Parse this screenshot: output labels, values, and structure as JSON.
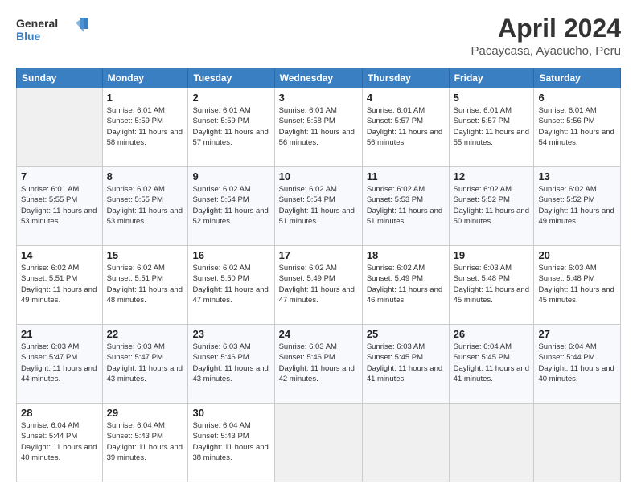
{
  "header": {
    "logo_line1": "General",
    "logo_line2": "Blue",
    "title": "April 2024",
    "location": "Pacaycasa, Ayacucho, Peru"
  },
  "weekdays": [
    "Sunday",
    "Monday",
    "Tuesday",
    "Wednesday",
    "Thursday",
    "Friday",
    "Saturday"
  ],
  "weeks": [
    [
      {
        "day": "",
        "empty": true
      },
      {
        "day": "1",
        "sunrise": "6:01 AM",
        "sunset": "5:59 PM",
        "daylight": "11 hours and 58 minutes."
      },
      {
        "day": "2",
        "sunrise": "6:01 AM",
        "sunset": "5:59 PM",
        "daylight": "11 hours and 57 minutes."
      },
      {
        "day": "3",
        "sunrise": "6:01 AM",
        "sunset": "5:58 PM",
        "daylight": "11 hours and 56 minutes."
      },
      {
        "day": "4",
        "sunrise": "6:01 AM",
        "sunset": "5:57 PM",
        "daylight": "11 hours and 56 minutes."
      },
      {
        "day": "5",
        "sunrise": "6:01 AM",
        "sunset": "5:57 PM",
        "daylight": "11 hours and 55 minutes."
      },
      {
        "day": "6",
        "sunrise": "6:01 AM",
        "sunset": "5:56 PM",
        "daylight": "11 hours and 54 minutes."
      }
    ],
    [
      {
        "day": "7",
        "sunrise": "6:01 AM",
        "sunset": "5:55 PM",
        "daylight": "11 hours and 53 minutes."
      },
      {
        "day": "8",
        "sunrise": "6:02 AM",
        "sunset": "5:55 PM",
        "daylight": "11 hours and 53 minutes."
      },
      {
        "day": "9",
        "sunrise": "6:02 AM",
        "sunset": "5:54 PM",
        "daylight": "11 hours and 52 minutes."
      },
      {
        "day": "10",
        "sunrise": "6:02 AM",
        "sunset": "5:54 PM",
        "daylight": "11 hours and 51 minutes."
      },
      {
        "day": "11",
        "sunrise": "6:02 AM",
        "sunset": "5:53 PM",
        "daylight": "11 hours and 51 minutes."
      },
      {
        "day": "12",
        "sunrise": "6:02 AM",
        "sunset": "5:52 PM",
        "daylight": "11 hours and 50 minutes."
      },
      {
        "day": "13",
        "sunrise": "6:02 AM",
        "sunset": "5:52 PM",
        "daylight": "11 hours and 49 minutes."
      }
    ],
    [
      {
        "day": "14",
        "sunrise": "6:02 AM",
        "sunset": "5:51 PM",
        "daylight": "11 hours and 49 minutes."
      },
      {
        "day": "15",
        "sunrise": "6:02 AM",
        "sunset": "5:51 PM",
        "daylight": "11 hours and 48 minutes."
      },
      {
        "day": "16",
        "sunrise": "6:02 AM",
        "sunset": "5:50 PM",
        "daylight": "11 hours and 47 minutes."
      },
      {
        "day": "17",
        "sunrise": "6:02 AM",
        "sunset": "5:49 PM",
        "daylight": "11 hours and 47 minutes."
      },
      {
        "day": "18",
        "sunrise": "6:02 AM",
        "sunset": "5:49 PM",
        "daylight": "11 hours and 46 minutes."
      },
      {
        "day": "19",
        "sunrise": "6:03 AM",
        "sunset": "5:48 PM",
        "daylight": "11 hours and 45 minutes."
      },
      {
        "day": "20",
        "sunrise": "6:03 AM",
        "sunset": "5:48 PM",
        "daylight": "11 hours and 45 minutes."
      }
    ],
    [
      {
        "day": "21",
        "sunrise": "6:03 AM",
        "sunset": "5:47 PM",
        "daylight": "11 hours and 44 minutes."
      },
      {
        "day": "22",
        "sunrise": "6:03 AM",
        "sunset": "5:47 PM",
        "daylight": "11 hours and 43 minutes."
      },
      {
        "day": "23",
        "sunrise": "6:03 AM",
        "sunset": "5:46 PM",
        "daylight": "11 hours and 43 minutes."
      },
      {
        "day": "24",
        "sunrise": "6:03 AM",
        "sunset": "5:46 PM",
        "daylight": "11 hours and 42 minutes."
      },
      {
        "day": "25",
        "sunrise": "6:03 AM",
        "sunset": "5:45 PM",
        "daylight": "11 hours and 41 minutes."
      },
      {
        "day": "26",
        "sunrise": "6:04 AM",
        "sunset": "5:45 PM",
        "daylight": "11 hours and 41 minutes."
      },
      {
        "day": "27",
        "sunrise": "6:04 AM",
        "sunset": "5:44 PM",
        "daylight": "11 hours and 40 minutes."
      }
    ],
    [
      {
        "day": "28",
        "sunrise": "6:04 AM",
        "sunset": "5:44 PM",
        "daylight": "11 hours and 40 minutes."
      },
      {
        "day": "29",
        "sunrise": "6:04 AM",
        "sunset": "5:43 PM",
        "daylight": "11 hours and 39 minutes."
      },
      {
        "day": "30",
        "sunrise": "6:04 AM",
        "sunset": "5:43 PM",
        "daylight": "11 hours and 38 minutes."
      },
      {
        "day": "",
        "empty": true
      },
      {
        "day": "",
        "empty": true
      },
      {
        "day": "",
        "empty": true
      },
      {
        "day": "",
        "empty": true
      }
    ]
  ]
}
